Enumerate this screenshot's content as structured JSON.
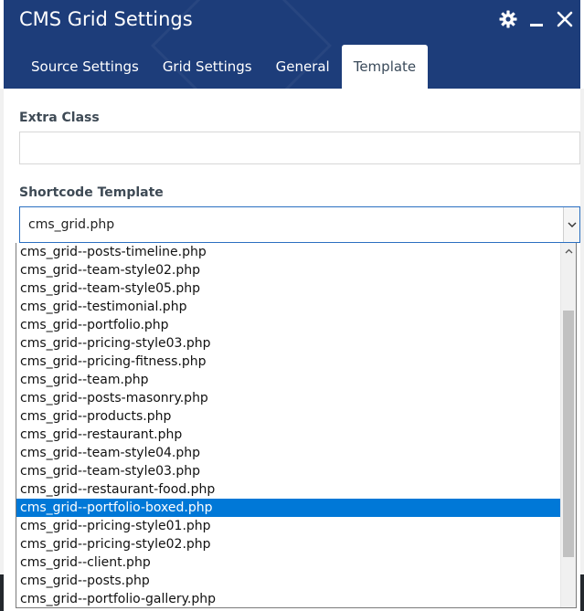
{
  "dialog": {
    "title": "CMS Grid Settings",
    "tabs": [
      {
        "label": "Source Settings"
      },
      {
        "label": "Grid Settings"
      },
      {
        "label": "General"
      },
      {
        "label": "Template"
      }
    ]
  },
  "fields": {
    "extra_class_label": "Extra Class",
    "extra_class_value": "",
    "shortcode_label": "Shortcode Template",
    "shortcode_selected": "cms_grid.php"
  },
  "dropdown": {
    "options": [
      "cms_grid--posts-timeline.php",
      "cms_grid--team-style02.php",
      "cms_grid--team-style05.php",
      "cms_grid--testimonial.php",
      "cms_grid--portfolio.php",
      "cms_grid--pricing-style03.php",
      "cms_grid--pricing-fitness.php",
      "cms_grid--team.php",
      "cms_grid--posts-masonry.php",
      "cms_grid--products.php",
      "cms_grid--restaurant.php",
      "cms_grid--team-style04.php",
      "cms_grid--team-style03.php",
      "cms_grid--restaurant-food.php",
      "cms_grid--portfolio-boxed.php",
      "cms_grid--pricing-style01.php",
      "cms_grid--pricing-style02.php",
      "cms_grid--client.php",
      "cms_grid--posts.php",
      "cms_grid--portfolio-gallery.php"
    ],
    "highlighted": "cms_grid--portfolio-boxed.php"
  },
  "icons": {
    "settings": "gear-icon",
    "minimize": "minimize-icon",
    "close": "close-icon"
  },
  "colors": {
    "header": "#1d3d7a",
    "highlight": "#0078d7",
    "select_border": "#2b6fc1"
  }
}
